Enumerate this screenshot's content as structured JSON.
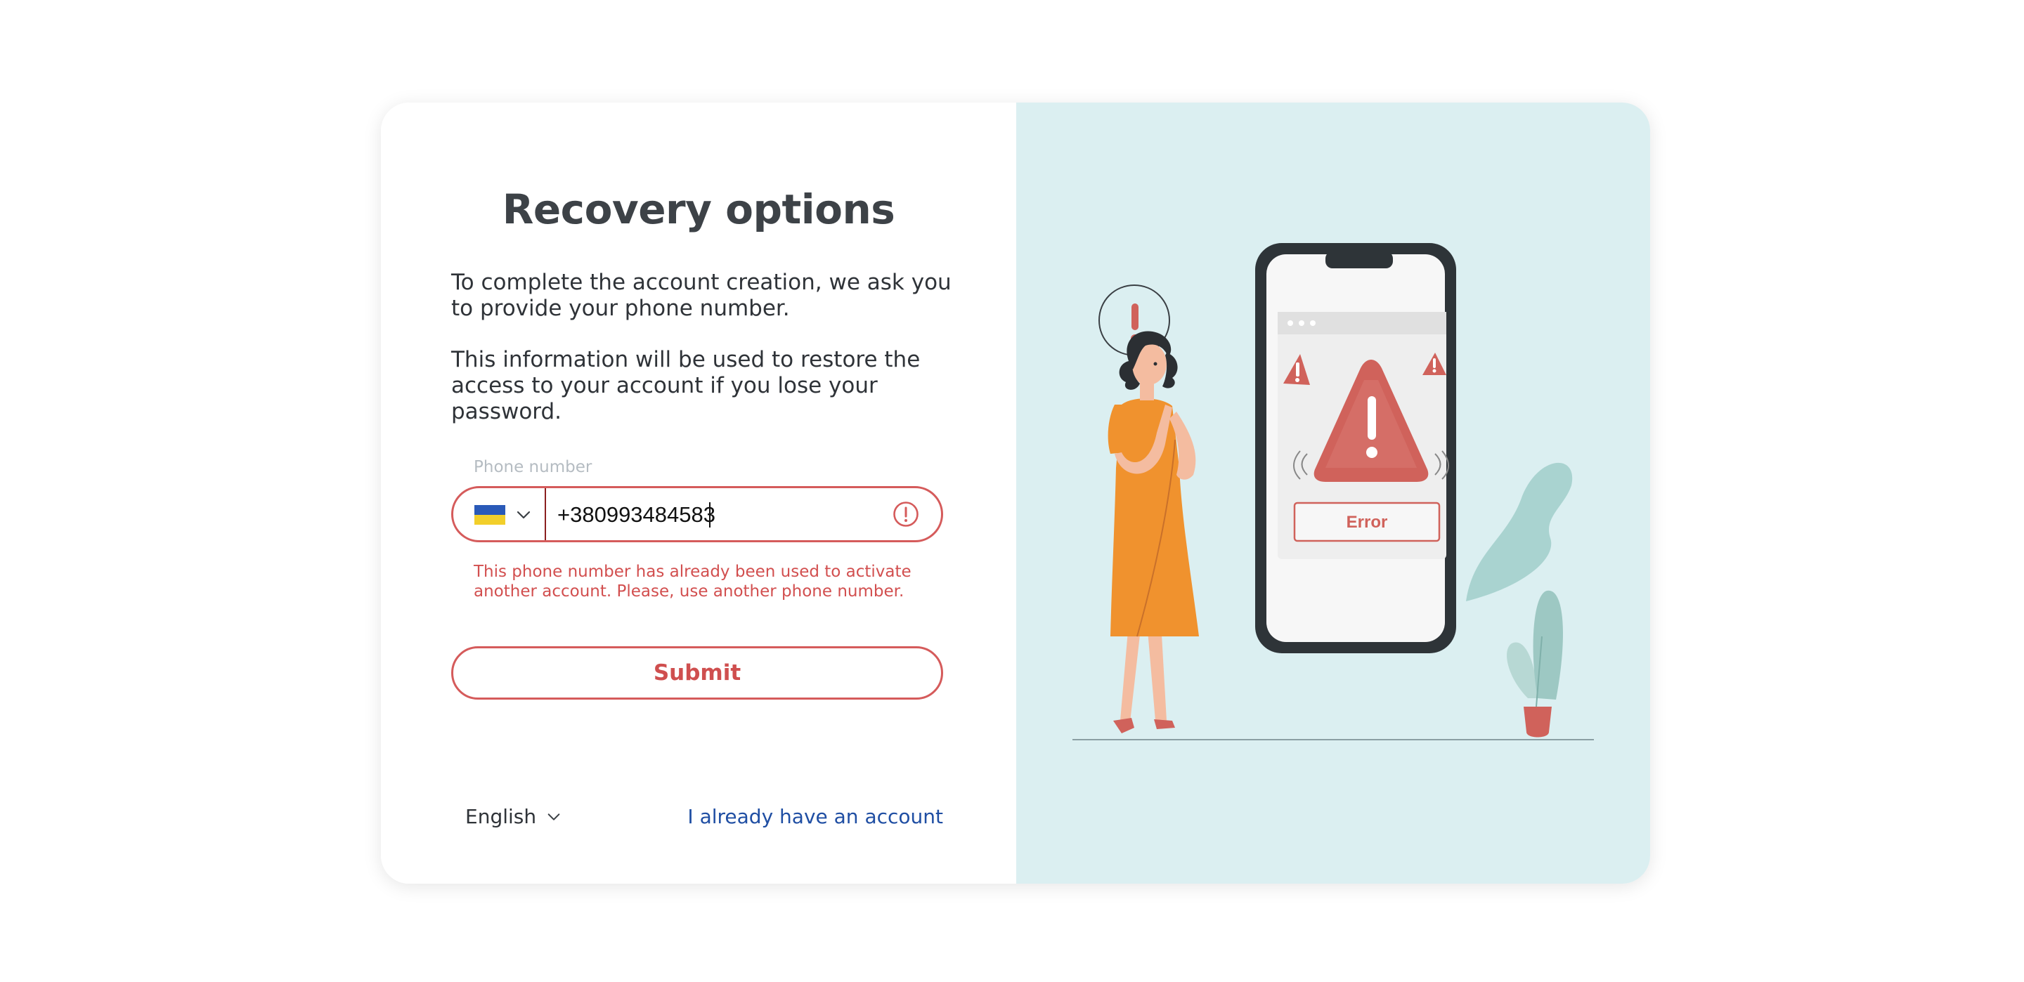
{
  "title": "Recovery options",
  "intro": "To complete the account creation, we ask you to provide your phone number.",
  "info": "This information will be used to restore the access to your account if you lose your password.",
  "phone": {
    "label": "Phone number",
    "value": "+380993484583",
    "country_flag": "flag-ukraine-icon",
    "error": "This phone number has already been used to activate another account. Please, use another phone number."
  },
  "submit_label": "Submit",
  "language": "English",
  "login_link": "I already have an account",
  "illustration": {
    "error_label": "Error"
  },
  "colors": {
    "accent_red": "#d55b5b",
    "link_blue": "#1f4ea3",
    "panel_bg": "#dbeff1"
  }
}
